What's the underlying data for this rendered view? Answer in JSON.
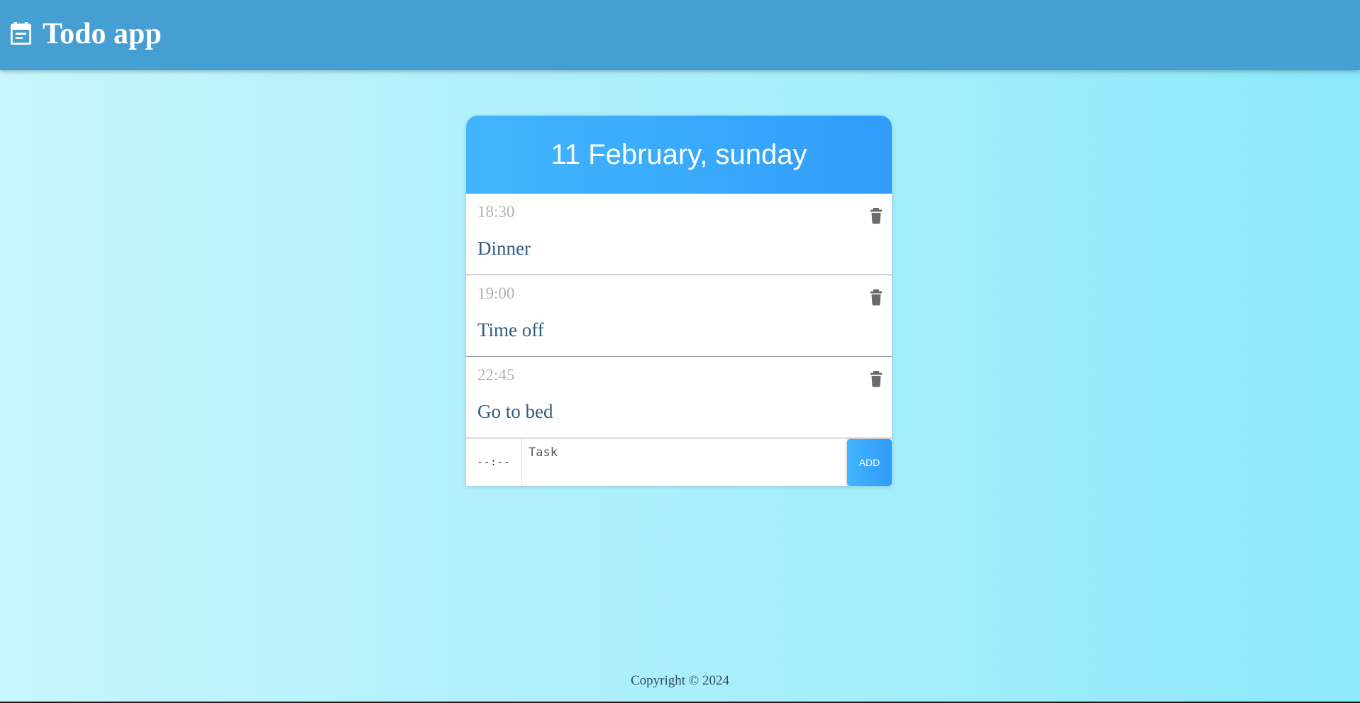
{
  "header": {
    "title": "Todo app",
    "icon": "calendar-icon",
    "background_color": "#459fd3"
  },
  "card": {
    "date_title": "11 February, sunday",
    "accent_color": "#3aaafc",
    "tasks": [
      {
        "time": "18:30",
        "text": "Dinner",
        "delete_icon": "trash-icon"
      },
      {
        "time": "19:00",
        "text": "Time off",
        "delete_icon": "trash-icon"
      },
      {
        "time": "22:45",
        "text": "Go to bed",
        "delete_icon": "trash-icon"
      }
    ],
    "add_form": {
      "time_value": "--:--",
      "task_placeholder": "Task",
      "add_label": "ADD"
    }
  },
  "footer": {
    "copyright": "Copyright © 2024"
  }
}
